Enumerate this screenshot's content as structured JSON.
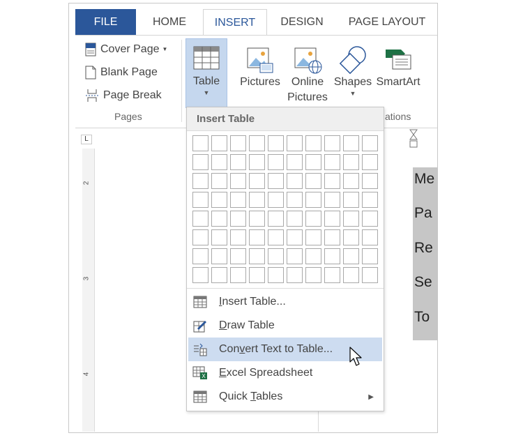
{
  "tabs": {
    "file": "FILE",
    "home": "HOME",
    "insert": "INSERT",
    "design": "DESIGN",
    "page_layout": "PAGE LAYOUT"
  },
  "ribbon": {
    "pages": {
      "cover_page": "Cover Page",
      "blank_page": "Blank Page",
      "page_break": "Page Break",
      "group_label": "Pages"
    },
    "table": {
      "label": "Table"
    },
    "pictures": {
      "label": "Pictures"
    },
    "online_pictures": {
      "line1": "Online",
      "line2": "Pictures"
    },
    "shapes": {
      "label": "Shapes"
    },
    "smartart": {
      "label": "SmartArt"
    },
    "illustrations_label_visible": "ations"
  },
  "dropdown": {
    "header": "Insert Table",
    "items": [
      {
        "pre": "",
        "ul": "I",
        "post": "nsert Table..."
      },
      {
        "pre": "",
        "ul": "D",
        "post": "raw Table"
      },
      {
        "pre": "Con",
        "ul": "v",
        "post": "ert Text to Table..."
      },
      {
        "pre": "",
        "ul": "E",
        "post": "xcel Spreadsheet"
      },
      {
        "pre": "Quick ",
        "ul": "T",
        "post": "ables"
      }
    ]
  },
  "ruler": {
    "corner": "L",
    "marks": [
      "2",
      "3",
      "4"
    ]
  },
  "document": {
    "lines": [
      "Me",
      "Pa",
      "Re",
      "Se",
      "To"
    ]
  },
  "colors": {
    "file_tab": "#2b579a",
    "insert_tab_text": "#2b579a",
    "table_button_bg": "#c5d7ee",
    "hover_item_bg": "#cddcf0",
    "selection": "#c6c6c6",
    "excel_green": "#1e7145"
  }
}
